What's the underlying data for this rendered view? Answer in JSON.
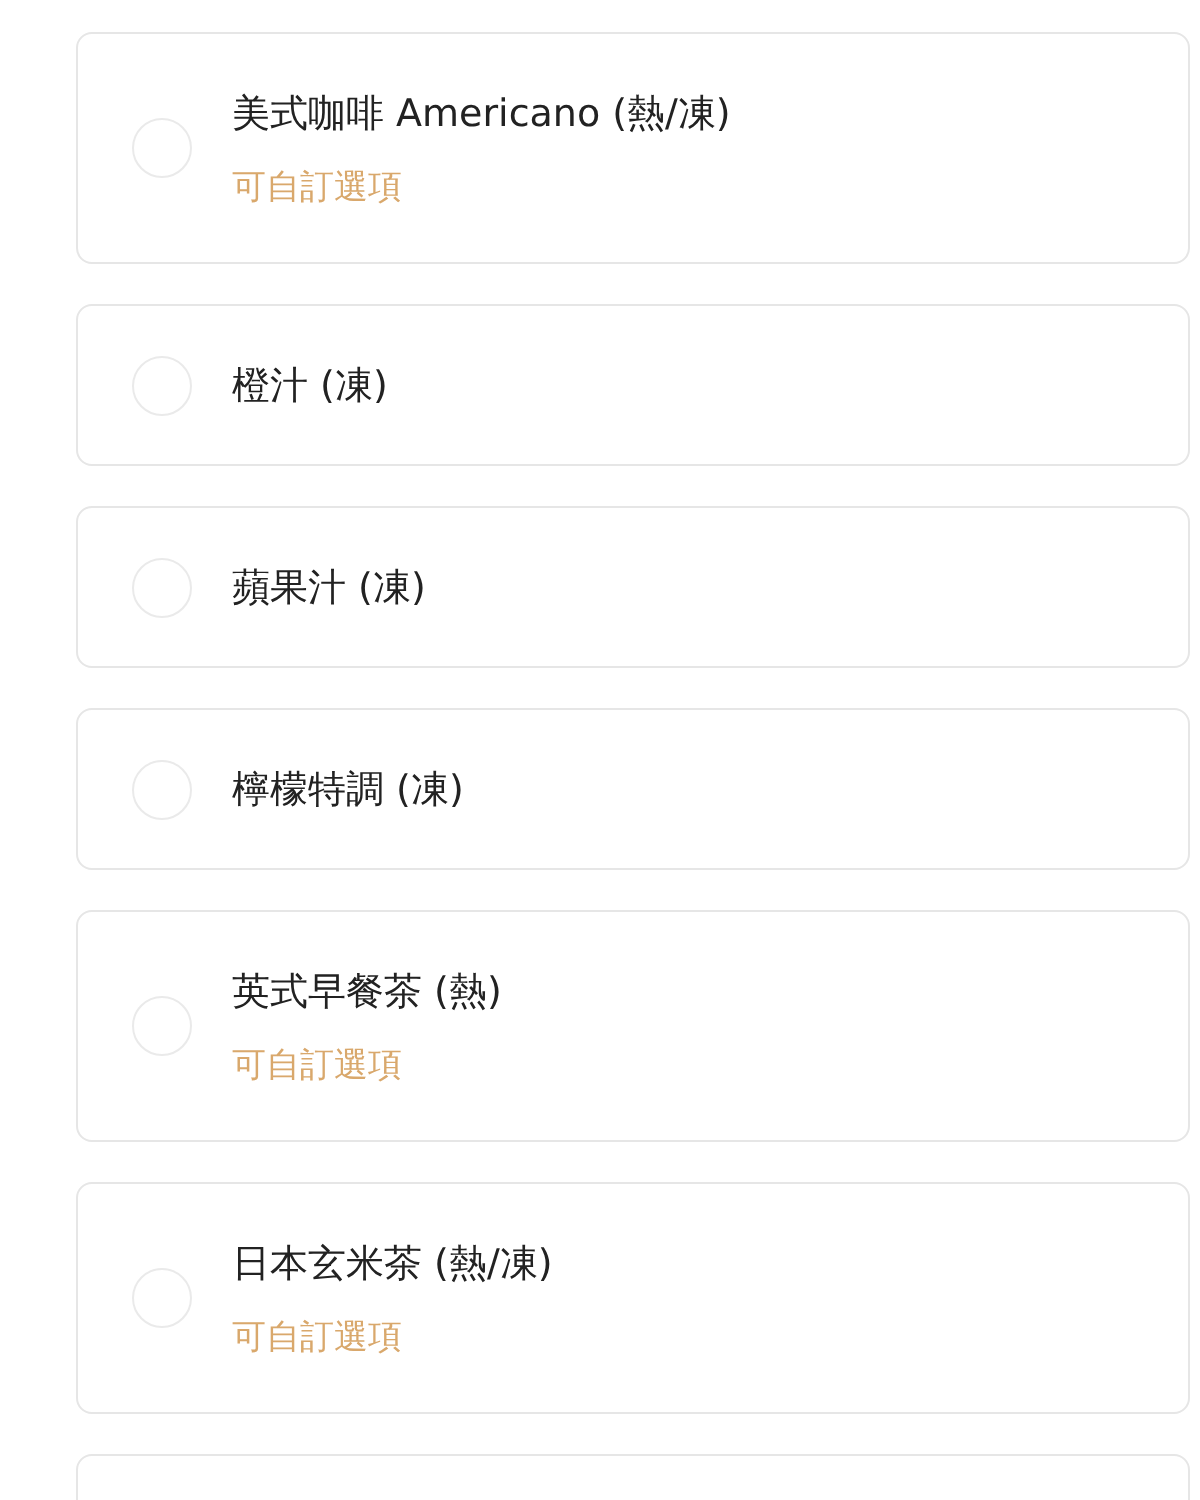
{
  "options": [
    {
      "name": "美式咖啡 Americano (熱/凍)",
      "note": "可自訂選項",
      "selected": false
    },
    {
      "name": "橙汁 (凍)",
      "selected": false
    },
    {
      "name": "蘋果汁 (凍)",
      "selected": false
    },
    {
      "name": "檸檬特調 (凍)",
      "selected": false
    },
    {
      "name": "英式早餐茶 (熱)",
      "note": "可自訂選項",
      "selected": false
    },
    {
      "name": "日本玄米茶 (熱/凍)",
      "note": "可自訂選項",
      "selected": false
    }
  ],
  "more_below": true
}
